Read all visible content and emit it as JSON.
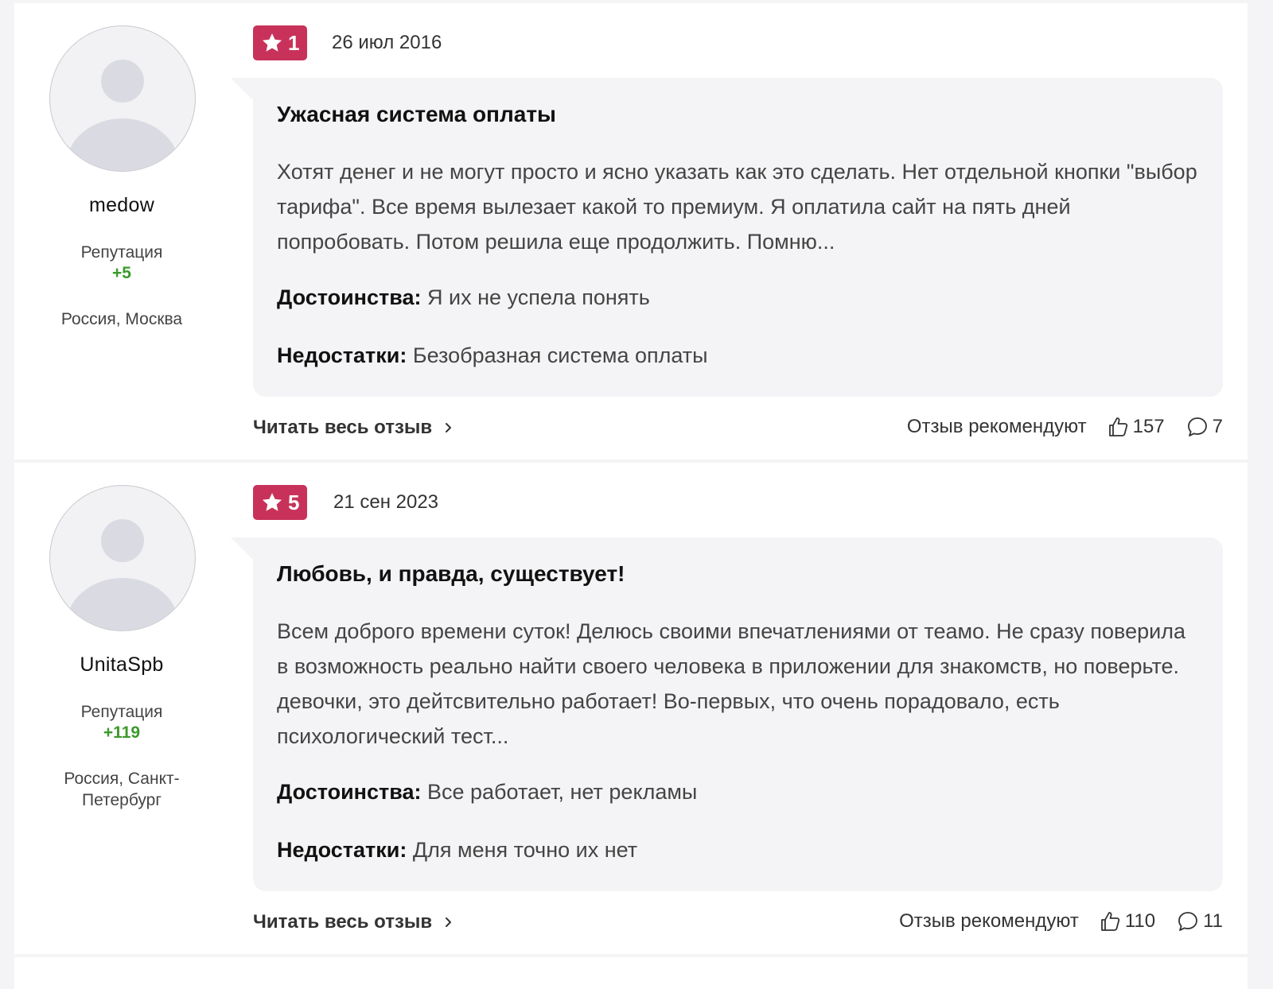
{
  "reviews": [
    {
      "author": {
        "name": "medow",
        "reputation_label": "Репутация",
        "reputation_value": "+5",
        "location": "Россия, Москва"
      },
      "rating": "1",
      "date": "26 июл 2016",
      "title": "Ужасная система оплаты",
      "text": "Хотят денег и не могут просто и ясно указать как это сделать. Нет отдельной кнопки \"выбор тарифа\". Все время вылезает какой то премиум. Я оплатила сайт на пять дней попробовать. Потом решила еще продолжить. Помню...",
      "pros_label": "Достоинства:",
      "pros": "Я их не успела понять",
      "cons_label": "Недостатки:",
      "cons": "Безобразная система оплаты",
      "read_more": "Читать весь отзыв",
      "recommend_label": "Отзыв рекомендуют",
      "likes": "157",
      "comments": "7"
    },
    {
      "author": {
        "name": "UnitaSpb",
        "reputation_label": "Репутация",
        "reputation_value": "+119",
        "location": "Россия, Санкт-Петербург"
      },
      "rating": "5",
      "date": "21 сен 2023",
      "title": "Любовь, и правда, существует!",
      "text": "Всем доброго времени суток! Делюсь своими впечатлениями от теамо. Не сразу поверила в возможность реально найти своего человека в приложении для знакомств, но поверьте. девочки, это дейтсвительно работает! Во-первых, что очень порадовало, есть психологический тест...",
      "pros_label": "Достоинства:",
      "pros": "Все работает, нет рекламы",
      "cons_label": "Недостатки:",
      "cons": "Для меня точно их нет",
      "read_more": "Читать весь отзыв",
      "recommend_label": "Отзыв рекомендуют",
      "likes": "110",
      "comments": "11"
    }
  ],
  "colors": {
    "badge": "#c8325a",
    "reputation": "#3a9a2a",
    "bubble": "#f4f4f6"
  },
  "icons": {
    "rating": "star-icon",
    "more": "chevron-right-icon",
    "likes": "thumbs-up-icon",
    "comments": "comment-icon"
  }
}
